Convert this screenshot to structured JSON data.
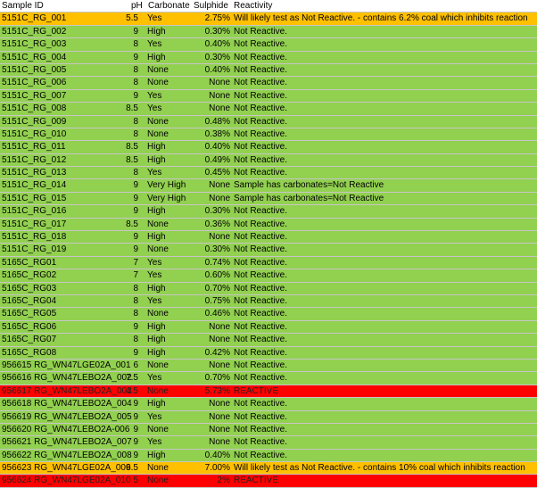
{
  "headers": {
    "sample_id": "Sample ID",
    "ph": "pH",
    "carbonate": "Carbonate",
    "sulphide": "Sulphide",
    "reactivity": "Reactivity"
  },
  "rows": [
    {
      "id": "5151C_RG_001",
      "ph": "5.5",
      "carbonate": "Yes",
      "sulphide": "2.75%",
      "reactivity": "Will likely test as Not Reactive. - contains 6.2% coal which inhibits reaction",
      "color": "orange"
    },
    {
      "id": "5151C_RG_002",
      "ph": "9",
      "carbonate": "High",
      "sulphide": "0.30%",
      "reactivity": "Not Reactive.",
      "color": "green"
    },
    {
      "id": "5151C_RG_003",
      "ph": "8",
      "carbonate": "Yes",
      "sulphide": "0.40%",
      "reactivity": "Not Reactive.",
      "color": "green"
    },
    {
      "id": "5151C_RG_004",
      "ph": "9",
      "carbonate": "High",
      "sulphide": "0.30%",
      "reactivity": "Not Reactive.",
      "color": "green"
    },
    {
      "id": "5151C_RG_005",
      "ph": "8",
      "carbonate": "None",
      "sulphide": "0.40%",
      "reactivity": "Not Reactive.",
      "color": "green"
    },
    {
      "id": "5151C_RG_006",
      "ph": "8",
      "carbonate": "None",
      "sulphide": "None",
      "reactivity": "Not Reactive.",
      "color": "green"
    },
    {
      "id": "5151C_RG_007",
      "ph": "9",
      "carbonate": "Yes",
      "sulphide": "None",
      "reactivity": "Not Reactive.",
      "color": "green"
    },
    {
      "id": "5151C_RG_008",
      "ph": "8.5",
      "carbonate": "Yes",
      "sulphide": "None",
      "reactivity": "Not Reactive.",
      "color": "green"
    },
    {
      "id": "5151C_RG_009",
      "ph": "8",
      "carbonate": "None",
      "sulphide": "0.48%",
      "reactivity": "Not Reactive.",
      "color": "green"
    },
    {
      "id": "5151C_RG_010",
      "ph": "8",
      "carbonate": "None",
      "sulphide": "0.38%",
      "reactivity": "Not Reactive.",
      "color": "green"
    },
    {
      "id": "5151C_RG_011",
      "ph": "8.5",
      "carbonate": "High",
      "sulphide": "0.40%",
      "reactivity": "Not Reactive.",
      "color": "green"
    },
    {
      "id": "5151C_RG_012",
      "ph": "8.5",
      "carbonate": "High",
      "sulphide": "0.49%",
      "reactivity": "Not Reactive.",
      "color": "green"
    },
    {
      "id": "5151C_RG_013",
      "ph": "8",
      "carbonate": "Yes",
      "sulphide": "0.45%",
      "reactivity": "Not Reactive.",
      "color": "green"
    },
    {
      "id": "5151C_RG_014",
      "ph": "9",
      "carbonate": "Very High",
      "sulphide": "None",
      "reactivity": "Sample has carbonates=Not Reactive",
      "color": "green"
    },
    {
      "id": "5151C_RG_015",
      "ph": "9",
      "carbonate": "Very High",
      "sulphide": "None",
      "reactivity": "Sample has carbonates=Not Reactive",
      "color": "green"
    },
    {
      "id": "5151C_RG_016",
      "ph": "9",
      "carbonate": "High",
      "sulphide": "0.30%",
      "reactivity": "Not Reactive.",
      "color": "green"
    },
    {
      "id": "5151C_RG_017",
      "ph": "8.5",
      "carbonate": "None",
      "sulphide": "0.36%",
      "reactivity": "Not Reactive.",
      "color": "green"
    },
    {
      "id": "5151C_RG_018",
      "ph": "9",
      "carbonate": "High",
      "sulphide": "None",
      "reactivity": "Not Reactive.",
      "color": "green"
    },
    {
      "id": "5151C_RG_019",
      "ph": "9",
      "carbonate": "None",
      "sulphide": "0.30%",
      "reactivity": "Not Reactive.",
      "color": "green"
    },
    {
      "id": "5165C_RG01",
      "ph": "7",
      "carbonate": "Yes",
      "sulphide": "0.74%",
      "reactivity": "Not Reactive.",
      "color": "green"
    },
    {
      "id": "5165C_RG02",
      "ph": "7",
      "carbonate": "Yes",
      "sulphide": "0.60%",
      "reactivity": "Not Reactive.",
      "color": "green"
    },
    {
      "id": "5165C_RG03",
      "ph": "8",
      "carbonate": "High",
      "sulphide": "0.70%",
      "reactivity": "Not Reactive.",
      "color": "green"
    },
    {
      "id": "5165C_RG04",
      "ph": "8",
      "carbonate": "Yes",
      "sulphide": "0.75%",
      "reactivity": "Not Reactive.",
      "color": "green"
    },
    {
      "id": "5165C_RG05",
      "ph": "8",
      "carbonate": "None",
      "sulphide": "0.46%",
      "reactivity": "Not Reactive.",
      "color": "green"
    },
    {
      "id": "5165C_RG06",
      "ph": "9",
      "carbonate": "High",
      "sulphide": "None",
      "reactivity": "Not Reactive.",
      "color": "green"
    },
    {
      "id": "5165C_RG07",
      "ph": "8",
      "carbonate": "High",
      "sulphide": "None",
      "reactivity": "Not Reactive.",
      "color": "green"
    },
    {
      "id": "5165C_RG08",
      "ph": "9",
      "carbonate": "High",
      "sulphide": "0.42%",
      "reactivity": "Not Reactive.",
      "color": "green"
    },
    {
      "id": "956615 RG_WN47LGE02A_001",
      "ph": "6",
      "carbonate": "None",
      "sulphide": "None",
      "reactivity": "Not Reactive.",
      "color": "green"
    },
    {
      "id": "956616 RG_WN47LEBO2A_002",
      "ph": "7.5",
      "carbonate": "Yes",
      "sulphide": "0.70%",
      "reactivity": "Not Reactive.",
      "color": "green"
    },
    {
      "id": "956617 RG_WN47LEBO2A_003",
      "ph": "4.5",
      "carbonate": "None",
      "sulphide": "5.73%",
      "reactivity": "REACTIVE",
      "color": "red"
    },
    {
      "id": "956618 RG_WN47LEBO2A_004",
      "ph": "9",
      "carbonate": "High",
      "sulphide": "None",
      "reactivity": "Not Reactive.",
      "color": "green"
    },
    {
      "id": "956619 RG_WN47LEBO2A_005",
      "ph": "9",
      "carbonate": "Yes",
      "sulphide": "None",
      "reactivity": "Not Reactive.",
      "color": "green"
    },
    {
      "id": "956620 RG_WN47LEBO2A-006",
      "ph": "9",
      "carbonate": "None",
      "sulphide": "None",
      "reactivity": "Not Reactive.",
      "color": "green"
    },
    {
      "id": "956621 RG_WN47LEBO2A_007",
      "ph": "9",
      "carbonate": "Yes",
      "sulphide": "None",
      "reactivity": "Not Reactive.",
      "color": "green"
    },
    {
      "id": "956622 RG_WN47LEBO2A_008",
      "ph": "9",
      "carbonate": "High",
      "sulphide": "0.40%",
      "reactivity": "Not Reactive.",
      "color": "green"
    },
    {
      "id": "956623 RG_WN47LGE02A_009",
      "ph": "6.5",
      "carbonate": "None",
      "sulphide": "7.00%",
      "reactivity": "Will likely test as Not Reactive. - contains 10% coal which inhibits reaction",
      "color": "orange"
    },
    {
      "id": "956624 RG_WN47LGE02A_010",
      "ph": "5",
      "carbonate": "None",
      "sulphide": "2%",
      "reactivity": "REACTIVE",
      "color": "red"
    }
  ],
  "colors": {
    "green": "#92d050",
    "orange": "#ffc000",
    "red": "#ff0000"
  }
}
